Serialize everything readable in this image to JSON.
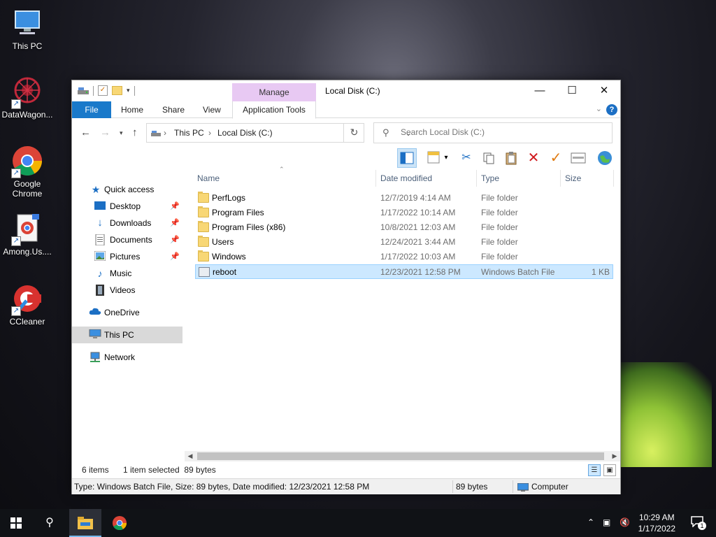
{
  "desktop": {
    "icons": [
      {
        "label": "This PC"
      },
      {
        "label": "DataWagon..."
      },
      {
        "label": "Google Chrome"
      },
      {
        "label": "Among.Us...."
      },
      {
        "label": "CCleaner"
      }
    ]
  },
  "window": {
    "title": "Local Disk (C:)",
    "contextual_tab": "Manage",
    "ribbon_tabs": [
      "File",
      "Home",
      "Share",
      "View",
      "Application Tools"
    ],
    "address": {
      "segments": [
        "This PC",
        "Local Disk (C:)"
      ]
    },
    "search_placeholder": "Search Local Disk (C:)",
    "nav": {
      "quick_access": "Quick access",
      "pinned": [
        "Desktop",
        "Downloads",
        "Documents",
        "Pictures"
      ],
      "others": [
        "Music",
        "Videos"
      ],
      "onedrive": "OneDrive",
      "this_pc": "This PC",
      "network": "Network"
    },
    "columns": [
      "Name",
      "Date modified",
      "Type",
      "Size"
    ],
    "files": [
      {
        "name": "PerfLogs",
        "date": "12/7/2019 4:14 AM",
        "type": "File folder",
        "size": ""
      },
      {
        "name": "Program Files",
        "date": "1/17/2022 10:14 AM",
        "type": "File folder",
        "size": ""
      },
      {
        "name": "Program Files (x86)",
        "date": "10/8/2021 12:03 AM",
        "type": "File folder",
        "size": ""
      },
      {
        "name": "Users",
        "date": "12/24/2021 3:44 AM",
        "type": "File folder",
        "size": ""
      },
      {
        "name": "Windows",
        "date": "1/17/2022 10:03 AM",
        "type": "File folder",
        "size": ""
      },
      {
        "name": "reboot",
        "date": "12/23/2021 12:58 PM",
        "type": "Windows Batch File",
        "size": "1 KB"
      }
    ],
    "status": {
      "count": "6 items",
      "selected": "1 item selected  89 bytes"
    },
    "details_bar": {
      "info": "Type: Windows Batch File, Size: 89 bytes, Date modified: 12/23/2021 12:58 PM",
      "size": "89 bytes",
      "location": "Computer"
    }
  },
  "taskbar": {
    "time": "10:29 AM",
    "date": "1/17/2022",
    "notifications": "1"
  },
  "colors": {
    "accent": "#1979ca",
    "manage_tab": "#e8c9f3",
    "selection": "#cce8ff"
  }
}
